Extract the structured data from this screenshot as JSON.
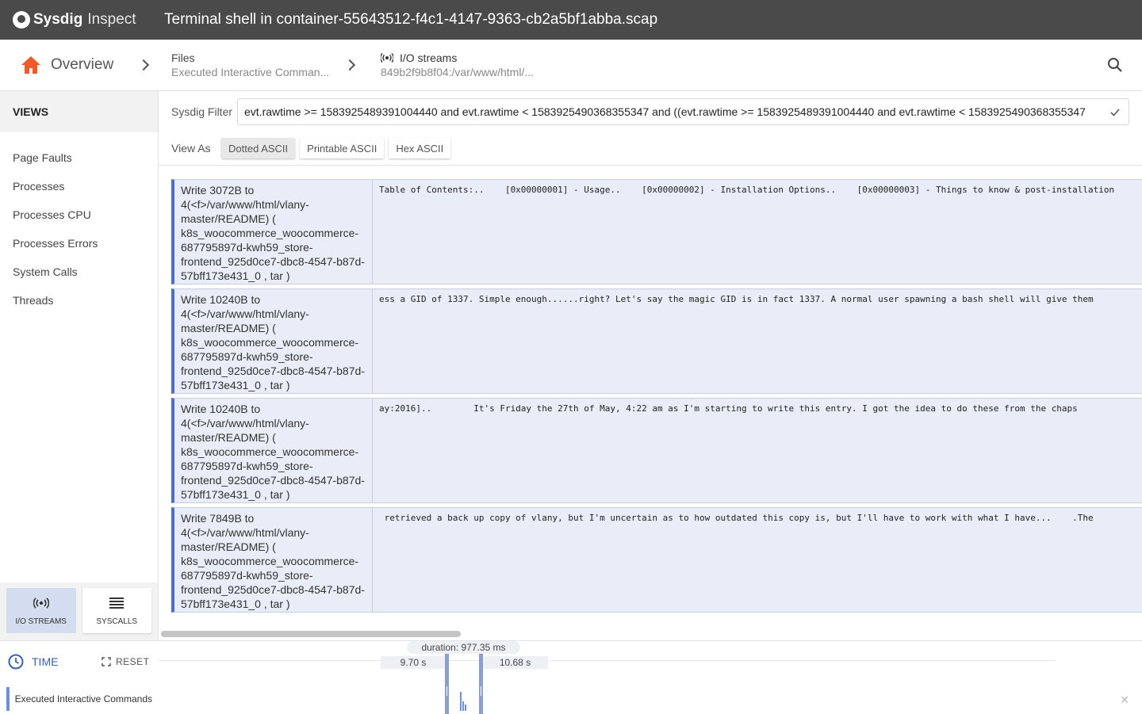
{
  "app": {
    "brand": "Sysdig",
    "product": "Inspect",
    "window_title": "Terminal shell in container-55643512-f4c1-4147-9363-cb2a5bf1abba.scap"
  },
  "breadcrumb": {
    "home_label": "Overview",
    "files_title": "Files",
    "files_subtitle": "Executed Interactive Comman...",
    "io_title": "I/O streams",
    "io_subtitle": "849b2f9b8f04:/var/www/html/..."
  },
  "sidebar": {
    "heading": "VIEWS",
    "items": [
      {
        "label": "Page Faults"
      },
      {
        "label": "Processes"
      },
      {
        "label": "Processes CPU"
      },
      {
        "label": "Processes Errors"
      },
      {
        "label": "System Calls"
      },
      {
        "label": "Threads"
      }
    ],
    "tabs": [
      {
        "label": "I/O STREAMS",
        "active": true
      },
      {
        "label": "SYSCALLS",
        "active": false
      }
    ]
  },
  "filter": {
    "label": "Sysdig Filter",
    "value": "evt.rawtime >= 1583925489391004440 and evt.rawtime < 1583925490368355347 and ((evt.rawtime >= 1583925489391004440 and evt.rawtime < 1583925490368355347"
  },
  "view_as": {
    "label": "View As",
    "options": [
      "Dotted ASCII",
      "Printable ASCII",
      "Hex ASCII"
    ],
    "selected": "Dotted ASCII"
  },
  "streams": [
    {
      "desc": "Write 3072B to 4(<f>/var/www/html/vlany-master/README) ( k8s_woocommerce_woocommerce-687795897d-kwh59_store-frontend_925d0ce7-dbc8-4547-b87d-57bff173e431_0 , tar )",
      "data": "Table of Contents:..    [0x00000001] - Usage..    [0x00000002] - Installation Options..    [0x00000003] - Things to know & post-installation"
    },
    {
      "desc": "Write 10240B to 4(<f>/var/www/html/vlany-master/README) ( k8s_woocommerce_woocommerce-687795897d-kwh59_store-frontend_925d0ce7-dbc8-4547-b87d-57bff173e431_0 , tar )",
      "data": "ess a GID of 1337. Simple enough......right? Let's say the magic GID is in fact 1337. A normal user spawning a bash shell will give them"
    },
    {
      "desc": "Write 10240B to 4(<f>/var/www/html/vlany-master/README) ( k8s_woocommerce_woocommerce-687795897d-kwh59_store-frontend_925d0ce7-dbc8-4547-b87d-57bff173e431_0 , tar )",
      "data": "ay:2016]..        It's Friday the 27th of May, 4:22 am as I'm starting to write this entry. I got the idea to do these from the chaps"
    },
    {
      "desc": "Write 7849B to 4(<f>/var/www/html/vlany-master/README) ( k8s_woocommerce_woocommerce-687795897d-kwh59_store-frontend_925d0ce7-dbc8-4547-b87d-57bff173e431_0 , tar )",
      "data": " retrieved a back up copy of vlany, but I'm uncertain as to how outdated this copy is, but I'll have to work with what I have...    .The"
    }
  ],
  "timeline": {
    "time_label": "TIME",
    "reset_label": "RESET",
    "duration": "duration: 977.35 ms",
    "start": "9.70 s",
    "end": "10.68 s",
    "event_label": "Executed Interactive Commands"
  },
  "colors": {
    "accent": "#3a5fb5",
    "home_icon": "#f05a28",
    "titlebar": "#4a4a4a",
    "row_bg": "#e8edf7",
    "row_border": "#4a6fc3"
  }
}
